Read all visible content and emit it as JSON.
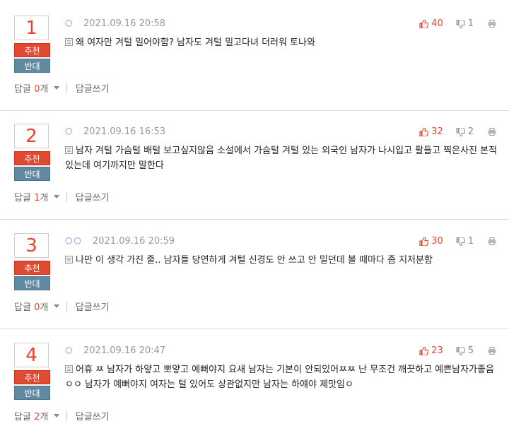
{
  "comments": [
    {
      "rank": "1",
      "vote_up": "추천",
      "vote_down": "반대",
      "author_mark": "○",
      "date": "2021.09.16 20:58",
      "likes": "40",
      "dislikes": "1",
      "text": "왜 여자만 겨털 밀어야함? 남자도 겨털 밀고다녀 더러워 토나와",
      "reply_prefix": "답글 ",
      "reply_count": "0",
      "reply_suffix": "개",
      "write_reply": "답글쓰기"
    },
    {
      "rank": "2",
      "vote_up": "추천",
      "vote_down": "반대",
      "author_mark": "○",
      "date": "2021.09.16 16:53",
      "likes": "32",
      "dislikes": "2",
      "text": "남자 겨털 가슴털 배털 보고싶지않음 소설에서 가슴털 겨털 있는 외국인 남자가 나시입고 팔들고 찍은사진 본적있는데 여기까지만 말한다",
      "reply_prefix": "답글 ",
      "reply_count": "1",
      "reply_suffix": "개",
      "write_reply": "답글쓰기"
    },
    {
      "rank": "3",
      "vote_up": "추천",
      "vote_down": "반대",
      "author_mark": "○○",
      "date": "2021.09.16 20:59",
      "likes": "30",
      "dislikes": "1",
      "text": "나만 이 생각 가진 줄.. 남자들 당연하게 겨털 신경도 안 쓰고 안 밀던데 볼 때마다 좀 지저분함",
      "reply_prefix": "답글 ",
      "reply_count": "0",
      "reply_suffix": "개",
      "write_reply": "답글쓰기"
    },
    {
      "rank": "4",
      "vote_up": "추천",
      "vote_down": "반대",
      "author_mark": "○",
      "date": "2021.09.16 20:47",
      "likes": "23",
      "dislikes": "5",
      "text": "어휴 ㅉ 남자가 하얗고 뽀얗고 예뻐야지 요새 남자는 기본이 안되있어ㅉㅉ 난 무조건 깨끗하고 예쁜남자가좋음ㅇㅇ 남자가 예뻐야지 여자는 털 있어도 상관없지만 남자는 하얘야 제맛임ㅇ",
      "reply_prefix": "답글 ",
      "reply_count": "2",
      "reply_suffix": "개",
      "write_reply": "답글쓰기"
    }
  ],
  "colors": {
    "accent_red": "#e04a33",
    "vote_down_blue": "#5f8aa1",
    "author_blue": "#5b8ad6"
  },
  "icons": {
    "like": "thumbs-up-icon",
    "dislike": "thumbs-down-icon",
    "print": "print-icon",
    "document": "document-icon",
    "dropdown": "chevron-down-icon"
  }
}
